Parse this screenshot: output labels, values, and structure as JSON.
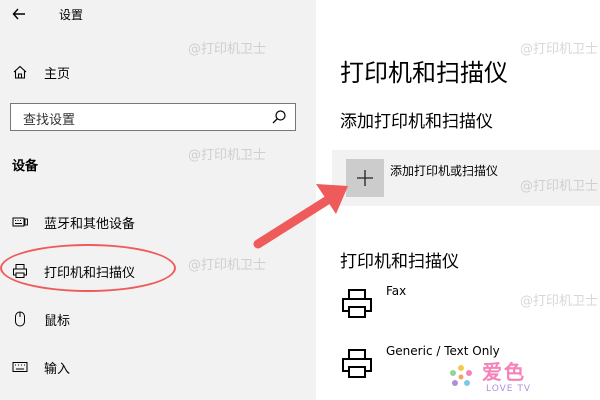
{
  "window": {
    "title": "设置"
  },
  "sidebar": {
    "home_label": "主页",
    "search_placeholder": "查找设置",
    "section_label": "设备",
    "items": [
      {
        "label": "蓝牙和其他设备",
        "icon": "keyboard-icon"
      },
      {
        "label": "打印机和扫描仪",
        "icon": "printer-icon"
      },
      {
        "label": "鼠标",
        "icon": "mouse-icon"
      },
      {
        "label": "输入",
        "icon": "keyboard-icon"
      }
    ]
  },
  "main": {
    "page_title": "打印机和扫描仪",
    "add_section_title": "添加打印机和扫描仪",
    "add_button_label": "添加打印机或扫描仪",
    "list_title": "打印机和扫描仪",
    "printers": [
      {
        "name": "Fax"
      },
      {
        "name": "Generic / Text Only"
      }
    ]
  },
  "watermark": {
    "text": "@打印机卫士"
  },
  "logo": {
    "main": "爱色",
    "sub": "LOVE TV"
  },
  "colors": {
    "sidebar_bg": "#f2f2f2",
    "annotation_red": "#ef5a5a",
    "add_button_bg": "#cccccc",
    "logo_pink": "#f582b9"
  }
}
